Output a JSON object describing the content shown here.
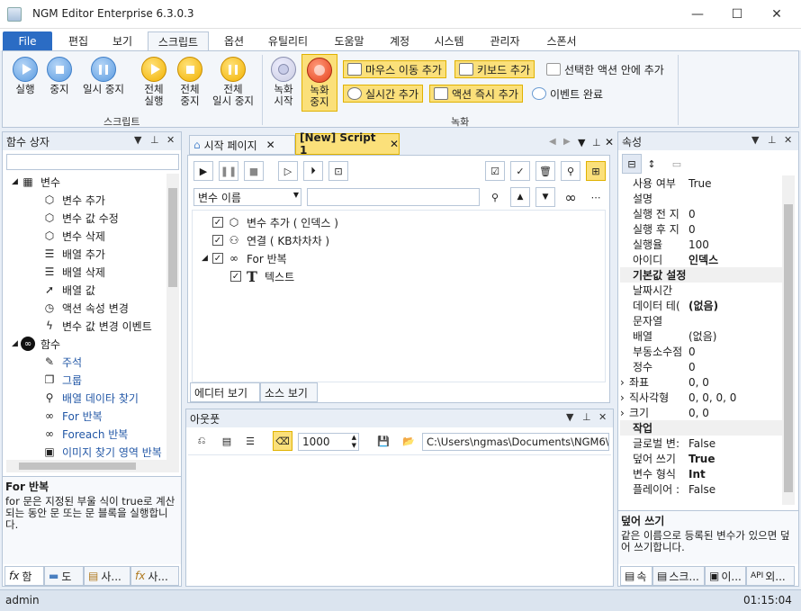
{
  "window": {
    "app": "NGM Editor",
    "edition": "Enterprise 6.3.0.3",
    "min": "—",
    "max": "☐",
    "close": "✕"
  },
  "menu": [
    "File",
    "편집",
    "보기",
    "스크립트",
    "옵션",
    "유틸리티",
    "도움말",
    "계정",
    "시스템",
    "관리자",
    "스폰서"
  ],
  "ribbon": {
    "script": {
      "run": "실행",
      "stop": "중지",
      "pause": "일시 중지",
      "run_all": "전체\n실행",
      "stop_all": "전체\n중지",
      "pause_all": "전체\n일시 중지",
      "group": "스크립트"
    },
    "record": {
      "record_start": "녹화\n시작",
      "record_stop": "녹화\n중지",
      "mouse_move": "마우스 이동 추가",
      "keyboard": "키보드 추가",
      "in_action": "선택한 액션 안에 추가",
      "realtime": "실시간 추가",
      "instant": "액션 즉시 추가",
      "event_done": "이벤트 완료",
      "group": "녹화"
    }
  },
  "toolbox": {
    "title": "함수 상자",
    "categories": [
      {
        "label": "변수",
        "items": [
          "변수 추가",
          "변수 값 수정",
          "변수 삭제",
          "배열 추가",
          "배열 삭제",
          "배열 값",
          "액션 속성 변경",
          "변수 값 변경 이벤트"
        ]
      },
      {
        "label": "함수",
        "items": [
          "주석",
          "그룹",
          "배열 데이타 찾기",
          "For 반복",
          "Foreach 반복",
          "이미지 찾기 영역 반복"
        ]
      }
    ],
    "desc_title": "For 반복",
    "desc_text": "for 문은 지정된 부울 식이 true로 계산되는 동안 문 또는 문 블록을 실행합니다.",
    "tabs": [
      "함",
      "도",
      "사...",
      "사..."
    ]
  },
  "editor": {
    "tabs": [
      "시작 페이지",
      "[New] Script 1"
    ],
    "search_field": "변수 이름",
    "tree": [
      "변수 추가 ( 인덱스 )",
      "연결 ( KB차차차 )",
      "For 반복",
      "텍스트"
    ],
    "bottom_tabs": [
      "에디터 보기",
      "소스 보기"
    ]
  },
  "output": {
    "title": "아웃풋",
    "count": "1000",
    "path": "C:\\Users\\ngmas\\Documents\\NGM6\\"
  },
  "properties": {
    "title": "속성",
    "rows": [
      {
        "k": "사용 여부",
        "v": "True"
      },
      {
        "k": "설명",
        "v": ""
      },
      {
        "k": "실행 전 지",
        "v": "0"
      },
      {
        "k": "실행 후 지",
        "v": "0"
      },
      {
        "k": "실행율",
        "v": "100"
      },
      {
        "k": "아이디",
        "v": "인덱스",
        "b": true
      },
      {
        "cat": "기본값 설정"
      },
      {
        "k": "날짜시간",
        "v": ""
      },
      {
        "k": "데이터 테(",
        "v": "(없음)",
        "b": true
      },
      {
        "k": "문자열",
        "v": ""
      },
      {
        "k": "배열",
        "v": "(없음)"
      },
      {
        "k": "부동소수점",
        "v": "0"
      },
      {
        "k": "정수",
        "v": "0"
      },
      {
        "k": "좌표",
        "v": "0, 0",
        "e": true
      },
      {
        "k": "직사각형",
        "v": "0, 0, 0, 0",
        "e": true
      },
      {
        "k": "크기",
        "v": "0, 0",
        "e": true
      },
      {
        "cat": "작업"
      },
      {
        "k": "글로벌 변:",
        "v": "False"
      },
      {
        "k": "덮어 쓰기",
        "v": "True",
        "b": true
      },
      {
        "k": "변수 형식",
        "v": "Int",
        "b": true
      },
      {
        "k": "플레이어 :",
        "v": "False"
      }
    ],
    "desc_title": "덮어 쓰기",
    "desc_text": "같은 이름으로 등록된 변수가 있으면 덮어 쓰기합니다.",
    "tabs": [
      "속",
      "스크...",
      "이...",
      "외..."
    ]
  },
  "status": {
    "user": "admin",
    "time": "01:15:04"
  }
}
